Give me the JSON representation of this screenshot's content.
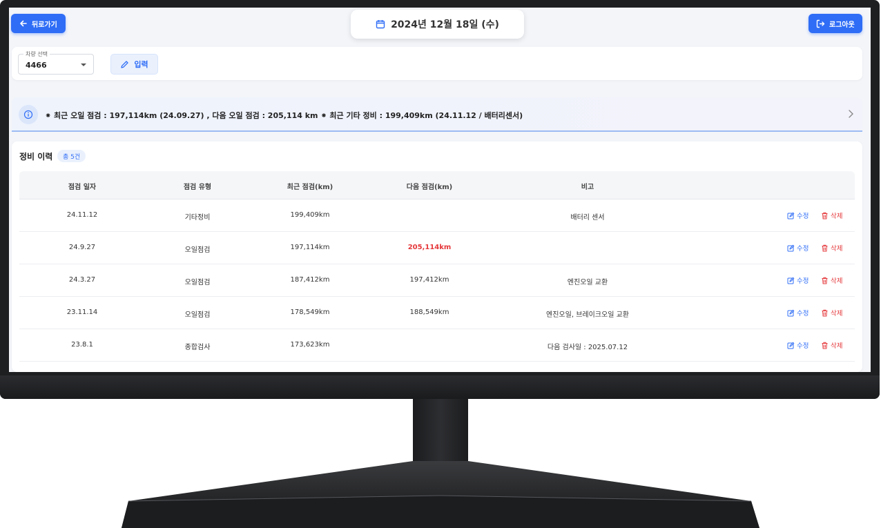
{
  "header": {
    "back_label": "뒤로가기",
    "date_label": "2024년 12월 18일 (수)",
    "logout_label": "로그아웃"
  },
  "filter": {
    "select_label": "차량 선택",
    "select_value": "4466",
    "input_label": "입력"
  },
  "info_banner": {
    "text": "⁕ 최근 오일 점검 : 197,114km (24.09.27) , 다음 오일 점검 : 205,114 km ⁕ 최근 기타 정비 : 199,409km (24.11.12 / 배터리센서)"
  },
  "history": {
    "title": "정비 이력",
    "count_badge": "총 5건",
    "columns": [
      "점검 일자",
      "점검 유형",
      "최근 점검(km)",
      "다음 점검(km)",
      "비고"
    ],
    "edit_label": "수정",
    "delete_label": "삭제",
    "rows": [
      {
        "date": "24.11.12",
        "type": "기타정비",
        "recent": "199,409km",
        "next": "",
        "note": "배터리 센서",
        "next_highlight": false
      },
      {
        "date": "24.9.27",
        "type": "오일점검",
        "recent": "197,114km",
        "next": "205,114km",
        "note": "",
        "next_highlight": true
      },
      {
        "date": "24.3.27",
        "type": "오일점검",
        "recent": "187,412km",
        "next": "197,412km",
        "note": "엔진오일 교환",
        "next_highlight": false
      },
      {
        "date": "23.11.14",
        "type": "오일점검",
        "recent": "178,549km",
        "next": "188,549km",
        "note": "엔진오일, 브레이크오일 교환",
        "next_highlight": false
      },
      {
        "date": "23.8.1",
        "type": "종합검사",
        "recent": "173,623km",
        "next": "",
        "note": "다음 검사일 : 2025.07.12",
        "next_highlight": false
      }
    ]
  },
  "colors": {
    "accent": "#2f6df6",
    "danger": "#e5383b",
    "bezel": "#1e1f21"
  }
}
